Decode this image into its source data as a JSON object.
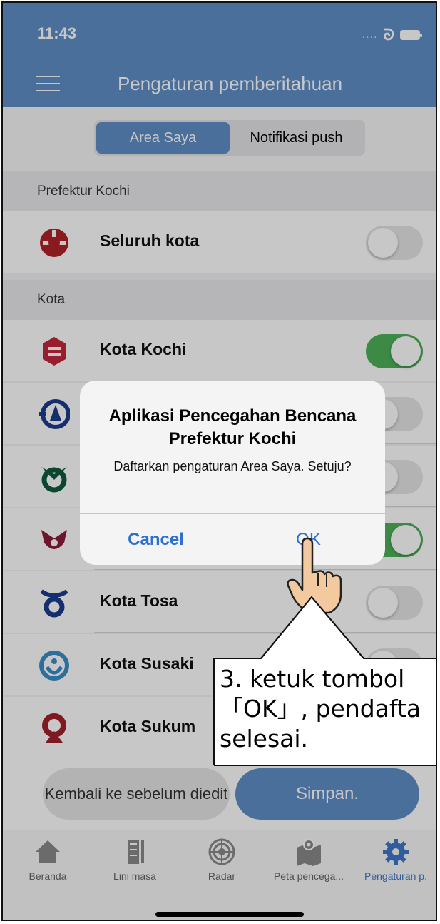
{
  "status": {
    "time": "11:43",
    "dots": "....",
    "link_glyph": "ᘐ"
  },
  "nav": {
    "title": "Pengaturan pemberitahuan"
  },
  "segment": {
    "tab1": "Area Saya",
    "tab2": "Notifikasi push"
  },
  "sections": [
    {
      "header": "Prefektur Kochi"
    },
    {
      "header": "Kota"
    }
  ],
  "rows": [
    {
      "label": "Seluruh kota",
      "on": false,
      "color": "#b0222a"
    },
    {
      "label": "Kota Kochi",
      "on": true,
      "color": "#c2273a"
    },
    {
      "label": "",
      "on": false,
      "color": "#1c3c8c"
    },
    {
      "label": "",
      "on": false,
      "color": "#0f5a3c"
    },
    {
      "label": "",
      "on": true,
      "color": "#8b1c3a"
    },
    {
      "label": "Kota Tosa",
      "on": false,
      "color": "#1c3c8c"
    },
    {
      "label": "Kota Susaki",
      "on": false,
      "color": "#3a8fc8"
    },
    {
      "label": "Kota Sukum",
      "on": false,
      "color": "#a0202a"
    }
  ],
  "buttons": {
    "reset": "Kembali ke sebelum diedit",
    "save": "Simpan."
  },
  "tabs": [
    {
      "label": "Beranda",
      "icon": "home-icon"
    },
    {
      "label": "Lini masa",
      "icon": "timeline-icon"
    },
    {
      "label": "Radar",
      "icon": "radar-icon"
    },
    {
      "label": "Peta pencega...",
      "icon": "map-icon"
    },
    {
      "label": "Pengaturan p.",
      "icon": "gear-icon",
      "active": true
    }
  ],
  "alert": {
    "title": "Aplikasi Pencegahan Bencana Prefektur Kochi",
    "message": "Daftarkan pengaturan Area Saya. Setuju?",
    "cancel": "Cancel",
    "ok": "OK"
  },
  "callout": {
    "line1": "3. ketuk tombol",
    "line2": "「OK」, pendafta",
    "line3": "selesai."
  },
  "colors": {
    "accent": "#5f8fc6",
    "toggle_on": "#4fb05a",
    "link_blue": "#2f6fd0"
  }
}
